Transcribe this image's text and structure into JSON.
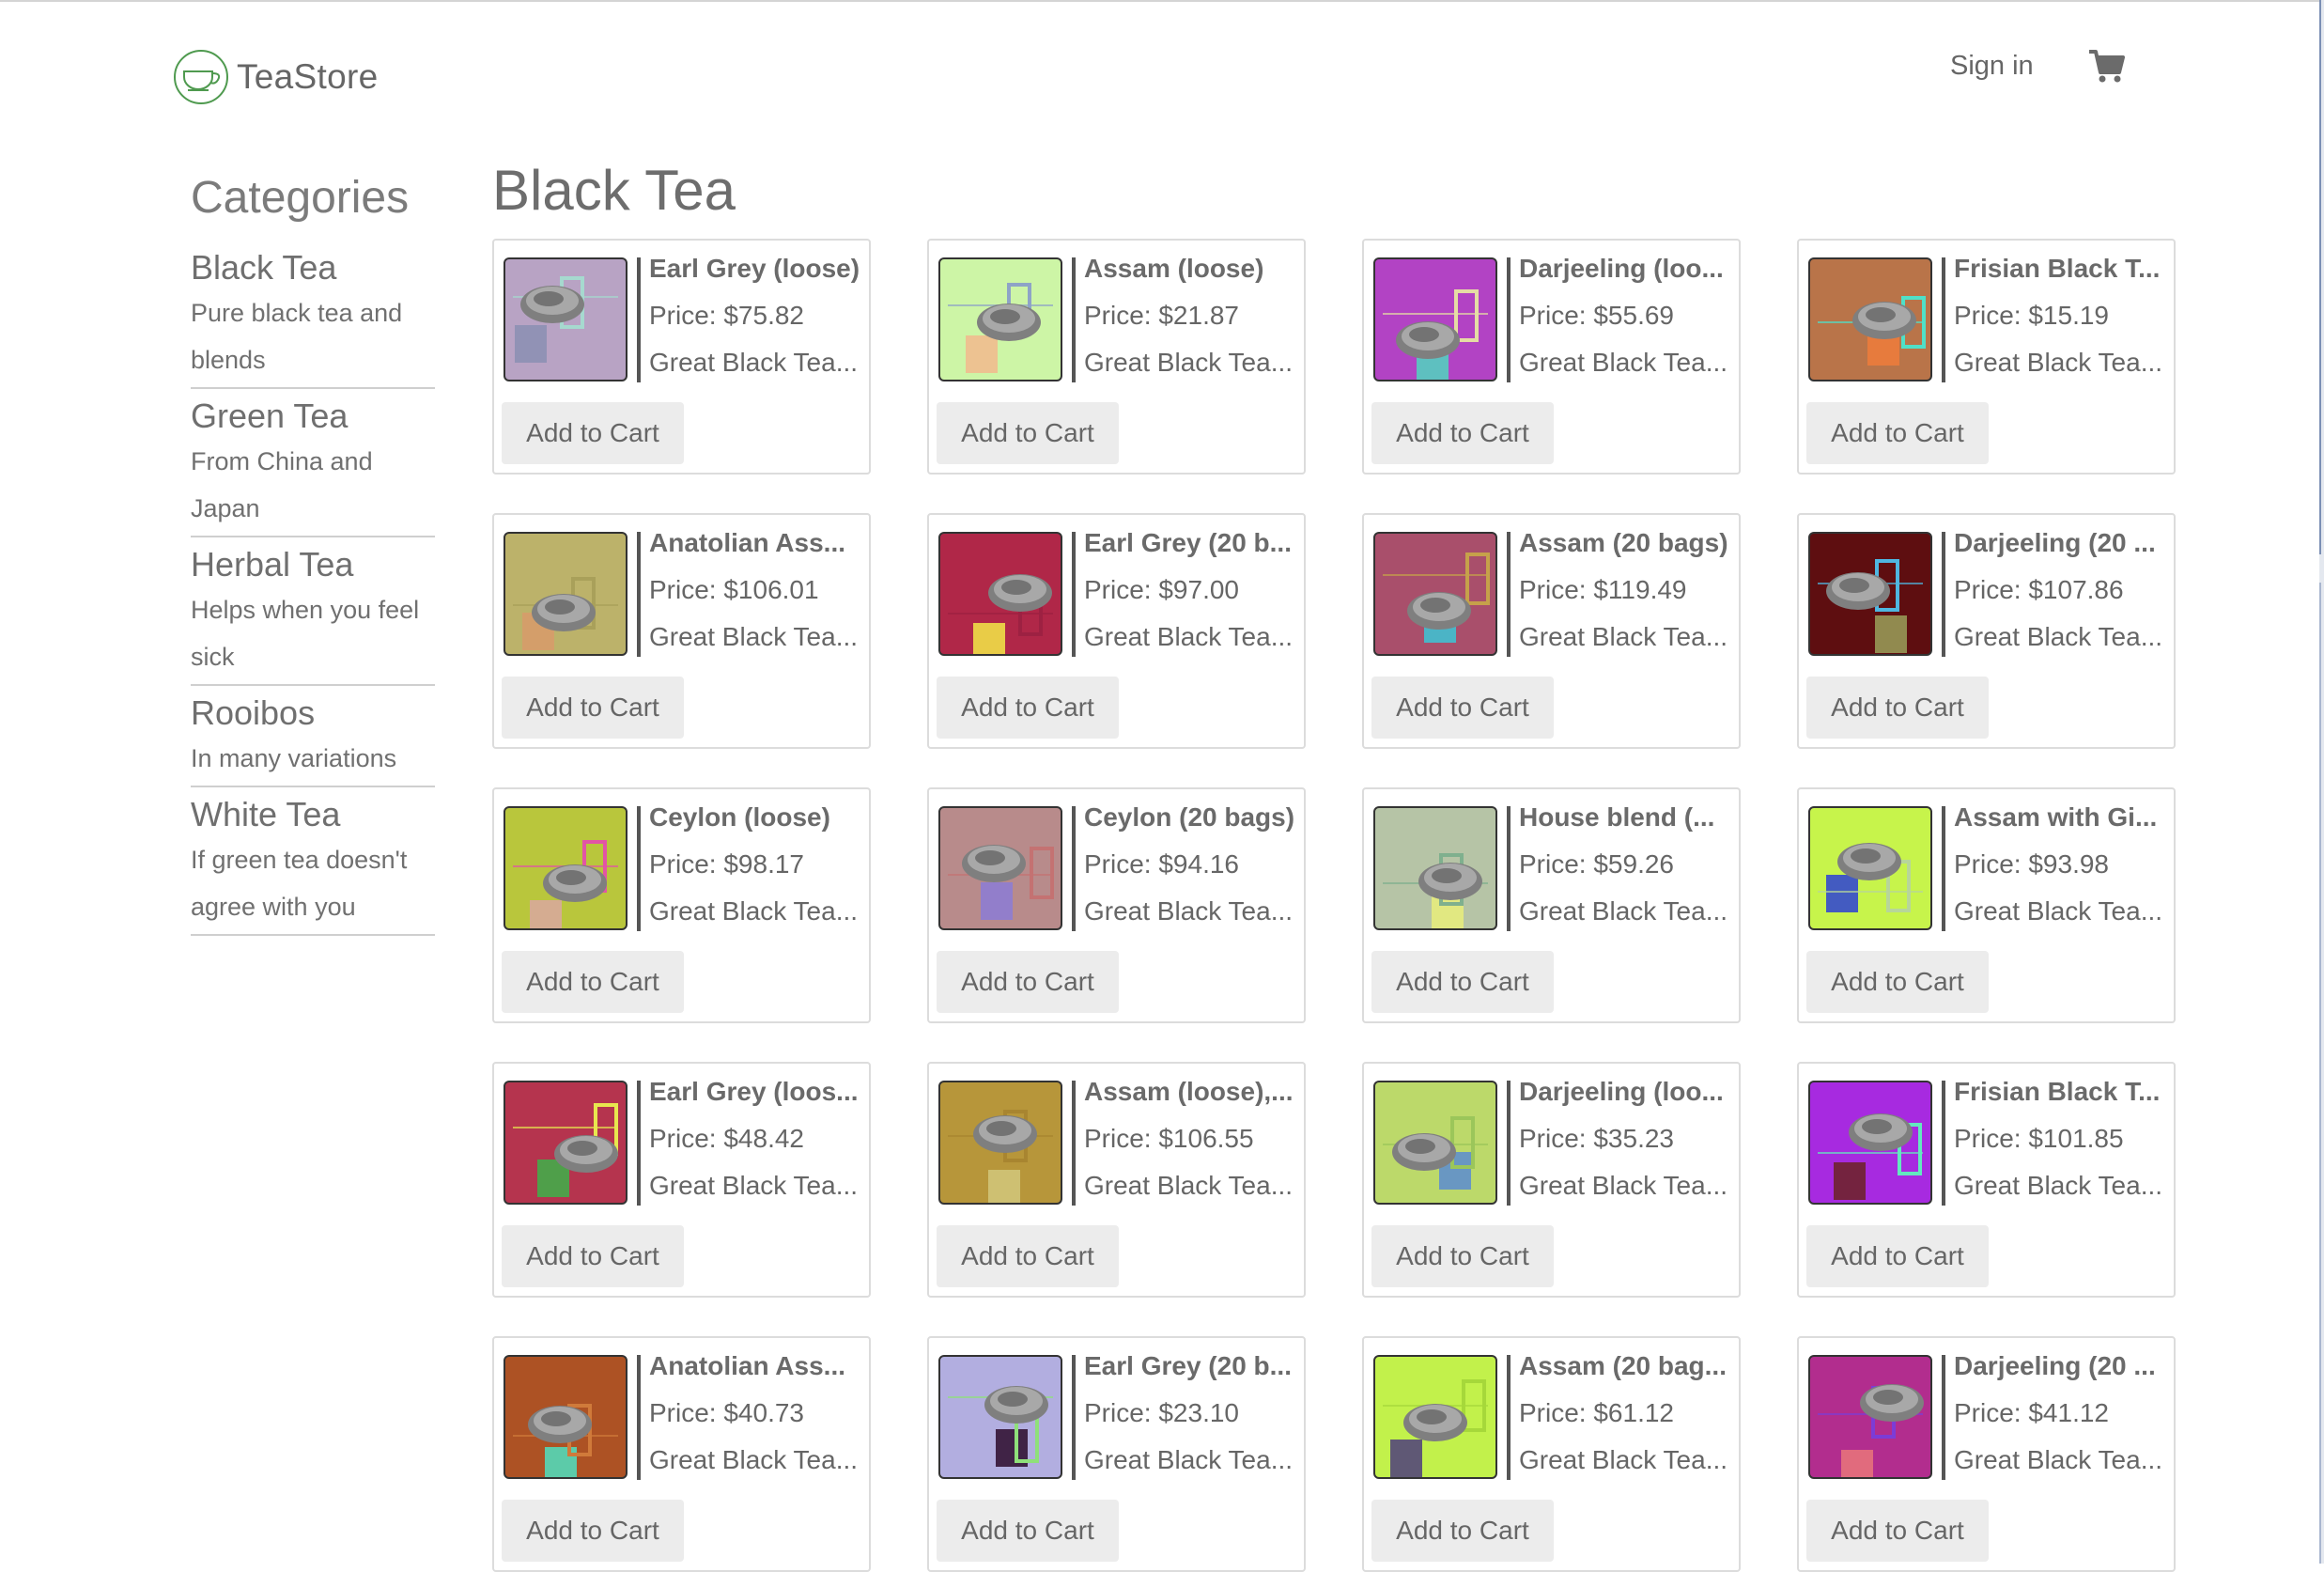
{
  "header": {
    "brand": "TeaStore",
    "signin_label": "Sign in"
  },
  "sidebar": {
    "title": "Categories",
    "categories": [
      {
        "name": "Black Tea",
        "desc": "Pure black tea and blends"
      },
      {
        "name": "Green Tea",
        "desc": "From China and Japan"
      },
      {
        "name": "Herbal Tea",
        "desc": "Helps when you feel sick"
      },
      {
        "name": "Rooibos",
        "desc": "In many variations"
      },
      {
        "name": "White Tea",
        "desc": "If green tea doesn't agree with you"
      }
    ]
  },
  "main": {
    "title": "Black Tea",
    "add_label": "Add to Cart",
    "products": [
      {
        "name": "Earl Grey (loose)",
        "price": "Price: $75.82",
        "desc": "Great Black Tea...",
        "bg": "#b8a3c4",
        "accents": [
          "#8a8fb3",
          "#a6d9cf"
        ]
      },
      {
        "name": "Assam (loose)",
        "price": "Price: $21.87",
        "desc": "Great Black Tea...",
        "bg": "#cdf5a6",
        "accents": [
          "#f2b98d",
          "#8ea3c7"
        ]
      },
      {
        "name": "Darjeeling (loo...",
        "price": "Price: $55.69",
        "desc": "Great Black Tea...",
        "bg": "#b243c4",
        "accents": [
          "#4fd6c0",
          "#e5dca4"
        ]
      },
      {
        "name": "Frisian Black T...",
        "price": "Price: $15.19",
        "desc": "Great Black Tea...",
        "bg": "#b97449",
        "accents": [
          "#ef7c3b",
          "#4fe0c8"
        ]
      },
      {
        "name": "Anatolian Ass...",
        "price": "Price: $106.01",
        "desc": "Great Black Tea...",
        "bg": "#bcb26a",
        "accents": [
          "#d89a6a",
          "#a9a05a"
        ]
      },
      {
        "name": "Earl Grey (20 b...",
        "price": "Price: $97.00",
        "desc": "Great Black Tea...",
        "bg": "#b02748",
        "accents": [
          "#f3ea48",
          "#9d2142"
        ]
      },
      {
        "name": "Assam (20 bags)",
        "price": "Price: $119.49",
        "desc": "Great Black Tea...",
        "bg": "#a94f6b",
        "accents": [
          "#3bc6d6",
          "#c6a14a"
        ]
      },
      {
        "name": "Darjeeling (20 ...",
        "price": "Price: $107.86",
        "desc": "Great Black Tea...",
        "bg": "#5e0e10",
        "accents": [
          "#9aa05a",
          "#4fb6e0"
        ]
      },
      {
        "name": "Ceylon (loose)",
        "price": "Price: $98.17",
        "desc": "Great Black Tea...",
        "bg": "#b9c63c",
        "accents": [
          "#d9a7a0",
          "#e254a6"
        ]
      },
      {
        "name": "Ceylon (20 bags)",
        "price": "Price: $94.16",
        "desc": "Great Black Tea...",
        "bg": "#b88b8b",
        "accents": [
          "#8b7bd6",
          "#c47272"
        ]
      },
      {
        "name": "House blend (...",
        "price": "Price: $59.26",
        "desc": "Great Black Tea...",
        "bg": "#b6c4a6",
        "accents": [
          "#e9ef7a",
          "#7fb08e"
        ]
      },
      {
        "name": "Assam with Gi...",
        "price": "Price: $93.98",
        "desc": "Great Black Tea...",
        "bg": "#c7f44b",
        "accents": [
          "#2c3fd6",
          "#b7d69a"
        ]
      },
      {
        "name": "Earl Grey (loos...",
        "price": "Price: $48.42",
        "desc": "Great Black Tea...",
        "bg": "#b5344e",
        "accents": [
          "#3db34a",
          "#e8e64e"
        ]
      },
      {
        "name": "Assam (loose),...",
        "price": "Price: $106.55",
        "desc": "Great Black Tea...",
        "bg": "#b7963a",
        "accents": [
          "#d2c87c",
          "#a88530"
        ]
      },
      {
        "name": "Darjeeling (loo...",
        "price": "Price: $35.23",
        "desc": "Great Black Tea...",
        "bg": "#bcd96a",
        "accents": [
          "#5b8bd1",
          "#9bc65a"
        ]
      },
      {
        "name": "Frisian Black T...",
        "price": "Price: $101.85",
        "desc": "Great Black Tea...",
        "bg": "#a72ae0",
        "accents": [
          "#6b2222",
          "#63e8bf"
        ]
      },
      {
        "name": "Anatolian Ass...",
        "price": "Price: $40.73",
        "desc": "Great Black Tea...",
        "bg": "#ad5224",
        "accents": [
          "#4ee0c1",
          "#d07a3a"
        ]
      },
      {
        "name": "Earl Grey (20 b...",
        "price": "Price: $23.10",
        "desc": "Great Black Tea...",
        "bg": "#b2aee0",
        "accents": [
          "#2b0a2a",
          "#8fe07a"
        ]
      },
      {
        "name": "Assam (20 bag...",
        "price": "Price: $61.12",
        "desc": "Great Black Tea...",
        "bg": "#c2f14b",
        "accents": [
          "#4d3d7c",
          "#a6d83a"
        ]
      },
      {
        "name": "Darjeeling (20 ...",
        "price": "Price: $41.12",
        "desc": "Great Black Tea...",
        "bg": "#b22d8e",
        "accents": [
          "#e9777a",
          "#7c3cd6"
        ]
      }
    ]
  }
}
